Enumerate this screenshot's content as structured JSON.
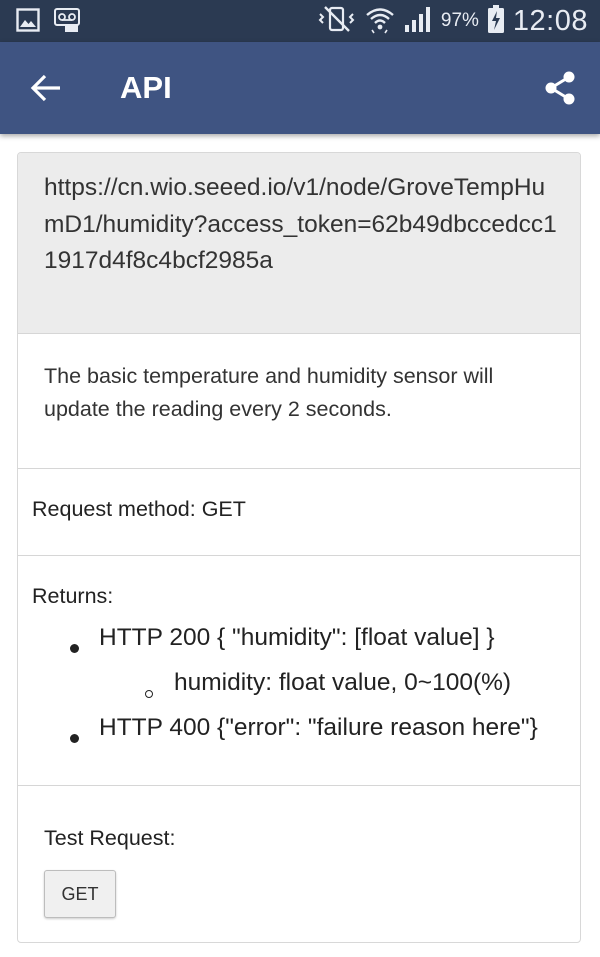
{
  "status_bar": {
    "battery_percent": "97%",
    "time": "12:08",
    "icons": [
      "gallery-icon",
      "voicemail-icon",
      "vibrate-icon",
      "wifi-icon",
      "signal-icon",
      "battery-charging-icon"
    ]
  },
  "app_bar": {
    "title": "API",
    "back_icon": "arrow-back-icon",
    "share_icon": "share-icon",
    "background_color": "#3f5482"
  },
  "endpoint": {
    "url": "https://cn.wio.seeed.io/v1/node/GroveTempHumD1/humidity?access_token=62b49dbccedcc11917d4f8c4bcf2985a"
  },
  "description": "The basic temperature and humidity sensor will update the reading every 2 seconds.",
  "request_method": "Request method: GET",
  "returns": {
    "label": "Returns:",
    "items": [
      {
        "text": "HTTP 200 { \"humidity\": [float value] }",
        "children": [
          "humidity: float value, 0~100(%)"
        ]
      },
      {
        "text": "HTTP 400 {\"error\": \"failure reason here\"}",
        "children": []
      }
    ]
  },
  "test_request": {
    "label": "Test Request:",
    "button_label": "GET"
  }
}
